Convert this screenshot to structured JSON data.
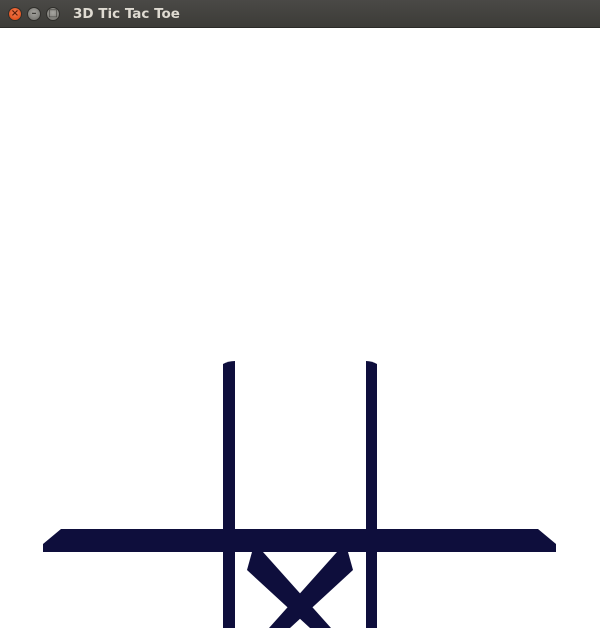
{
  "window": {
    "title": "3D Tic Tac Toe",
    "controls": {
      "close_glyph": "×",
      "minimize_glyph": "–",
      "maximize_glyph": "□"
    }
  },
  "scene": {
    "board_color": "#0e0e3c",
    "background_color": "#ffffff",
    "pieces": [
      {
        "type": "X",
        "cell": "bottom-center"
      }
    ]
  }
}
